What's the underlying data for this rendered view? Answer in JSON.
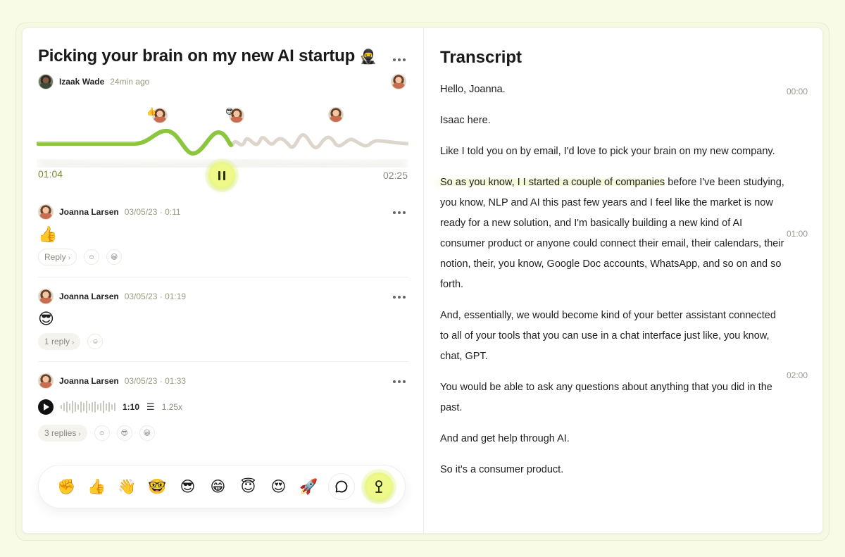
{
  "left": {
    "title": "Picking your brain on my new AI startup",
    "title_icon": "🥷",
    "author_name": "Izaak Wade",
    "author_time": "24min ago",
    "player": {
      "current_time": "01:04",
      "total_time": "02:25",
      "progress": 0.44,
      "marker_emojis": [
        "👍",
        "😎"
      ]
    },
    "comments": [
      {
        "name": "Joanna Larsen",
        "date": "03/05/23 · 0:11",
        "emoji": "👍",
        "reply_label": "Reply",
        "reaction": "😀"
      },
      {
        "name": "Joanna Larsen",
        "date": "03/05/23 · 01:19",
        "emoji": "😎",
        "reply_label": "1 reply"
      },
      {
        "name": "Joanna Larsen",
        "date": "03/05/23 · 01:33",
        "voice_duration": "1:10",
        "voice_speed": "1.25x",
        "reply_label": "3 replies",
        "reactions": [
          "😎",
          "😀"
        ]
      }
    ],
    "emoji_bar": [
      "✊",
      "👍",
      "👋",
      "🤓",
      "😎",
      "😁",
      "😇",
      "😍",
      "🚀"
    ]
  },
  "transcript": {
    "title": "Transcript",
    "paragraphs": [
      "Hello, Joanna.",
      "Isaac here.",
      "Like I told you on by email, I'd love to pick your brain on my new company.",
      "before I've been studying, you know, NLP and AI this past few years and I feel like the market is now ready for a new solution, and I'm basically building a new kind of AI consumer product or anyone could connect their email, their calendars, their notion, their, you know, Google Doc accounts, WhatsApp, and so on and so forth.",
      "And, essentially, we would become kind of your better assistant connected to all of your tools that you can use in a chat interface just like, you know, chat, GPT.",
      "You would be able to ask any questions about anything that you did in the past.",
      "And and get help through AI.",
      "So it's a consumer product."
    ],
    "highlight": "So as you know, I I started a couple of companies",
    "timestamps": [
      "00:00",
      "01:00",
      "02:00"
    ]
  },
  "colors": {
    "accent_green": "#8cc63f",
    "accent_lime": "#e6f57a",
    "wave_rest": "#ddd6cc",
    "background": "#f8fbe6"
  }
}
